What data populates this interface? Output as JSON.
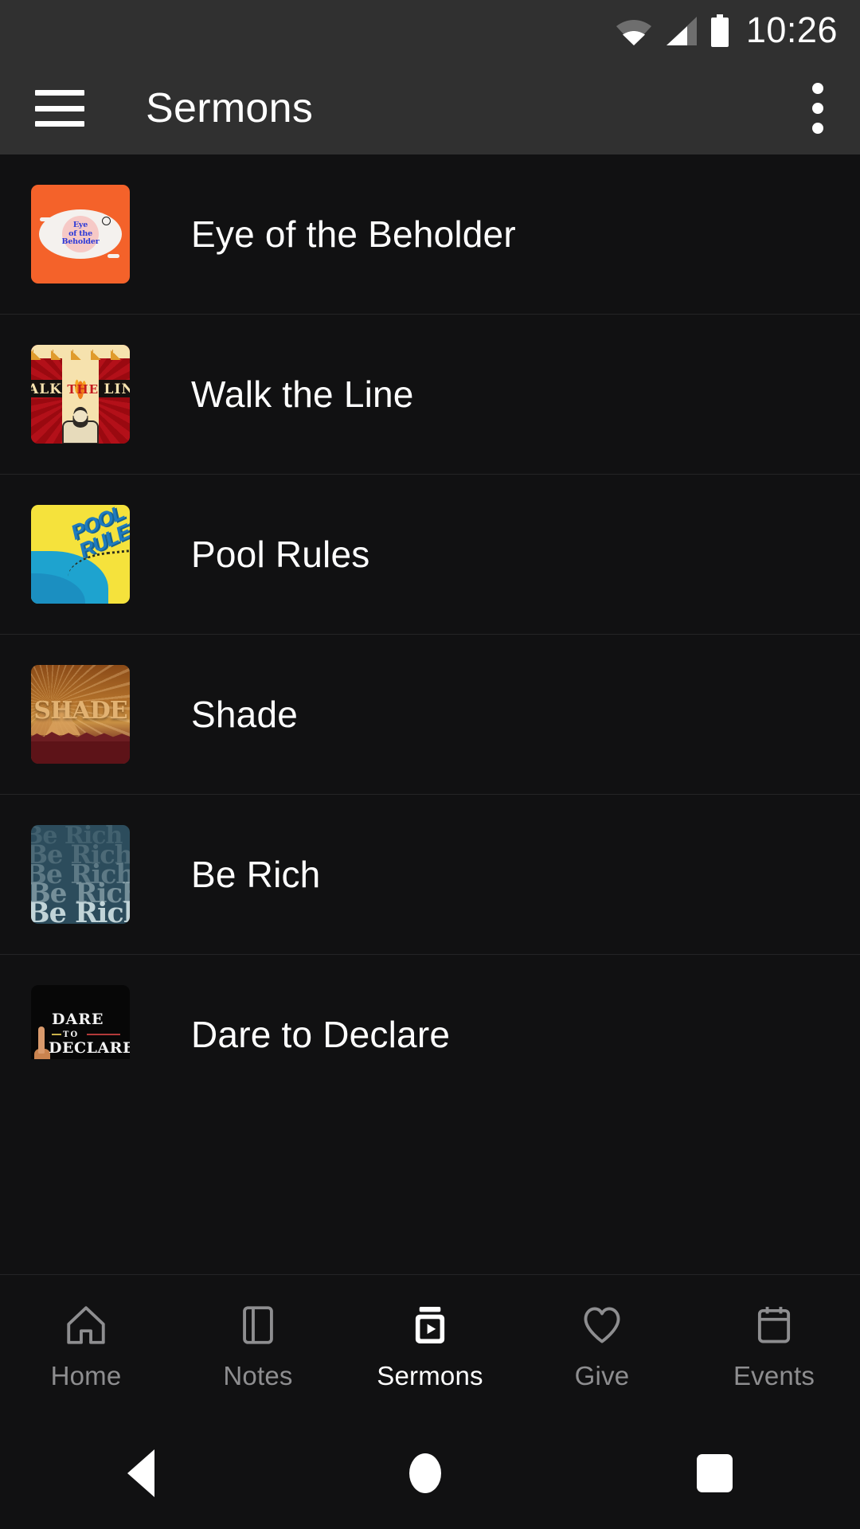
{
  "statusbar": {
    "time": "10:26",
    "icons": [
      "wifi-icon",
      "cellular-signal-icon",
      "battery-icon"
    ]
  },
  "appbar": {
    "menu_icon": "hamburger-menu-icon",
    "title": "Sermons",
    "overflow_icon": "more-options-icon"
  },
  "sermons": [
    {
      "title": "Eye of the Beholder",
      "art": "eye",
      "art_text": {
        "line1": "Eye",
        "line2": "of the",
        "line3": "Beholder"
      }
    },
    {
      "title": "Walk the Line",
      "art": "walk",
      "art_text": {
        "left": "ALK",
        "middle": "THE",
        "right": "LIN"
      }
    },
    {
      "title": "Pool Rules",
      "art": "pool",
      "art_text": {
        "line1": "POOL",
        "line2": "RULES"
      }
    },
    {
      "title": "Shade",
      "art": "shade",
      "art_text": {
        "line1": "SHADE"
      }
    },
    {
      "title": "Be Rich",
      "art": "rich",
      "art_text": {
        "line1": "Be Rich"
      }
    },
    {
      "title": "Dare to Declare",
      "art": "dare",
      "art_text": {
        "line1": "DARE",
        "line2": "TO",
        "line3": "DECLARE"
      }
    }
  ],
  "tabbar": {
    "active": "Sermons",
    "items": [
      {
        "label": "Home",
        "icon": "home-icon"
      },
      {
        "label": "Notes",
        "icon": "notes-icon"
      },
      {
        "label": "Sermons",
        "icon": "sermons-video-icon"
      },
      {
        "label": "Give",
        "icon": "heart-icon"
      },
      {
        "label": "Events",
        "icon": "calendar-icon"
      }
    ]
  },
  "androidnav": {
    "back": "back-triangle-icon",
    "home": "home-circle-icon",
    "recents": "recents-square-icon"
  },
  "colors": {
    "page_bg": "#111112",
    "chrome_bg": "#303030",
    "divider": "#242426",
    "text_primary": "#ffffff",
    "text_muted": "#8e8e90"
  }
}
